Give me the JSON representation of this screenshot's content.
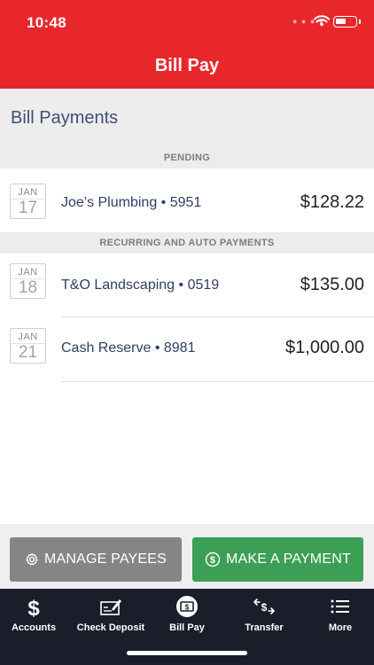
{
  "status": {
    "time": "10:48"
  },
  "nav": {
    "title": "Bill Pay"
  },
  "page": {
    "heading": "Bill Payments"
  },
  "groups": [
    {
      "label": "PENDING"
    },
    {
      "label": "RECURRING AND AUTO PAYMENTS"
    }
  ],
  "payments": [
    {
      "month": "JAN",
      "day": "17",
      "payee": "Joe’s Plumbing • 5951",
      "amount": "$128.22"
    },
    {
      "month": "JAN",
      "day": "18",
      "payee": "T&O Landscaping • 0519",
      "amount": "$135.00"
    },
    {
      "month": "JAN",
      "day": "21",
      "payee": "Cash Reserve • 8981",
      "amount": "$1,000.00"
    }
  ],
  "actions": {
    "manage_label": "MANAGE PAYEES",
    "make_label": "MAKE A PAYMENT"
  },
  "tabs": [
    {
      "label": "Accounts",
      "icon": "dollar-icon"
    },
    {
      "label": "Check Deposit",
      "icon": "check-deposit-icon"
    },
    {
      "label": "Bill Pay",
      "icon": "bill-pay-icon"
    },
    {
      "label": "Transfer",
      "icon": "transfer-icon"
    },
    {
      "label": "More",
      "icon": "list-icon"
    }
  ],
  "colors": {
    "brand_red": "#e8272b",
    "make_payment_green": "#3c9f55",
    "manage_gray": "#858585",
    "tabbar_dark": "#1a1e2b"
  }
}
